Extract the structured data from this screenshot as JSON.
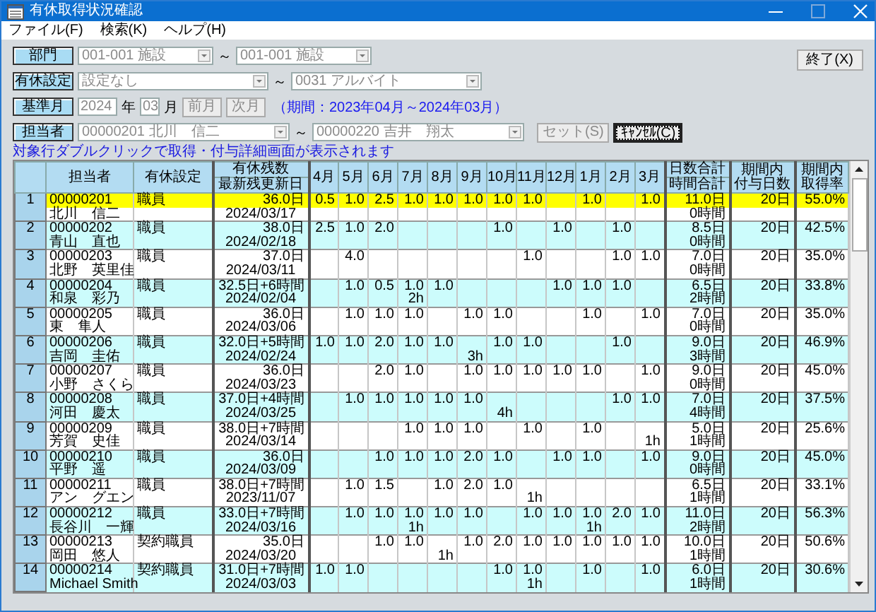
{
  "window": {
    "title": "有休取得状況確認"
  },
  "menu": [
    {
      "label": "ファイル(F)"
    },
    {
      "label": "検索(K)"
    },
    {
      "label": "ヘルプ(H)"
    }
  ],
  "filters": [
    {
      "label": "部門",
      "from": "001-001 施設",
      "separator": "～",
      "to": "001-001 施設",
      "disabled": true
    },
    {
      "label": "有休設定",
      "from": "設定なし",
      "separator": "～",
      "to": "0031 アルバイト",
      "disabled": true
    }
  ],
  "base_month": {
    "label": "基準月",
    "year": "2024",
    "year_unit": "年",
    "month": "03",
    "month_unit": "月",
    "prev": "前月",
    "next": "次月",
    "period": "（期間：2023年04月～2024年03月）",
    "disabled": true
  },
  "staff_range": {
    "label": "担当者",
    "from": "00000201 北川　信二",
    "separator": "～",
    "to": "00000220 吉井　翔太",
    "disabled": true,
    "set_button": {
      "label": "セット(S)",
      "disabled": true
    },
    "cancel_button": {
      "label": "ｷｬﾝｾﾙ(C)",
      "disabled": false
    }
  },
  "exit_button": "終了(X)",
  "hint": "対象行ダブルクリックで取得・付与詳細画面が表示されます",
  "table": {
    "columns": {
      "staff": "担当者",
      "setting": "有休設定",
      "balance": "有休残数",
      "updated": "最新残更新日",
      "months": [
        "4月",
        "5月",
        "6月",
        "7月",
        "8月",
        "9月",
        "10月",
        "11月",
        "12月",
        "1月",
        "2月",
        "3月"
      ],
      "day_total": "日数合計",
      "hour_total": "時間合計",
      "granted": [
        "期間内",
        "付与日数"
      ],
      "rate": [
        "期間内",
        "取得率"
      ]
    },
    "rows": [
      {
        "no": "1",
        "code": "00000201",
        "name": "北川　信二",
        "setting": "職員",
        "balance": "36.0日",
        "updated": "2024/03/17",
        "months": [
          {
            "kind": "taken",
            "days": "0.5"
          },
          {
            "kind": "taken",
            "days": "1.0"
          },
          {
            "kind": "taken",
            "days": "2.5"
          },
          {
            "kind": "taken",
            "days": "1.0"
          },
          {
            "kind": "taken",
            "days": "1.0"
          },
          {
            "kind": "taken",
            "days": "1.0"
          },
          {
            "kind": "taken",
            "days": "1.0"
          },
          {
            "kind": "taken",
            "days": "1.0"
          },
          {
            "kind": "blank"
          },
          {
            "kind": "taken",
            "days": "1.0"
          },
          {
            "kind": "blank"
          },
          {
            "kind": "taken",
            "days": "1.0"
          }
        ],
        "day_total": "11.0日",
        "hour_total": "0時間",
        "granted": "20日",
        "rate": "55.0%",
        "selected": true
      },
      {
        "no": "2",
        "code": "00000202",
        "name": "青山　直也",
        "setting": "職員",
        "balance": "38.0日",
        "updated": "2024/02/18",
        "months": [
          {
            "kind": "taken",
            "days": "2.5"
          },
          {
            "kind": "taken",
            "days": "1.0"
          },
          {
            "kind": "taken",
            "days": "2.0"
          },
          {
            "kind": "blank"
          },
          {
            "kind": "blank"
          },
          {
            "kind": "blank"
          },
          {
            "kind": "taken",
            "days": "1.0"
          },
          {
            "kind": "blank"
          },
          {
            "kind": "taken",
            "days": "1.0"
          },
          {
            "kind": "blank"
          },
          {
            "kind": "taken",
            "days": "1.0"
          },
          {
            "kind": "blank"
          }
        ],
        "day_total": "8.5日",
        "hour_total": "0時間",
        "granted": "20日",
        "rate": "42.5%",
        "selected": false
      },
      {
        "no": "3",
        "code": "00000203",
        "name": "北野　英里佳",
        "setting": "職員",
        "balance": "37.0日",
        "updated": "2024/03/11",
        "months": [
          {
            "kind": "blank"
          },
          {
            "kind": "taken",
            "days": "4.0"
          },
          {
            "kind": "blank"
          },
          {
            "kind": "blank"
          },
          {
            "kind": "blank"
          },
          {
            "kind": "blank"
          },
          {
            "kind": "blank"
          },
          {
            "kind": "taken",
            "days": "1.0"
          },
          {
            "kind": "blank"
          },
          {
            "kind": "blank"
          },
          {
            "kind": "taken",
            "days": "1.0"
          },
          {
            "kind": "taken",
            "days": "1.0"
          }
        ],
        "day_total": "7.0日",
        "hour_total": "0時間",
        "granted": "20日",
        "rate": "35.0%",
        "selected": false
      },
      {
        "no": "4",
        "code": "00000204",
        "name": "和泉　彩乃",
        "setting": "職員",
        "balance": "32.5日+6時間",
        "updated": "2024/02/04",
        "months": [
          {
            "kind": "blank"
          },
          {
            "kind": "taken",
            "days": "1.0"
          },
          {
            "kind": "taken",
            "days": "0.5"
          },
          {
            "kind": "taken",
            "days": "1.0",
            "hours": "2h"
          },
          {
            "kind": "taken",
            "days": "1.0"
          },
          {
            "kind": "blank"
          },
          {
            "kind": "blank"
          },
          {
            "kind": "blank"
          },
          {
            "kind": "taken",
            "days": "1.0"
          },
          {
            "kind": "taken",
            "days": "1.0"
          },
          {
            "kind": "taken",
            "days": "1.0"
          },
          {
            "kind": "blank"
          }
        ],
        "day_total": "6.5日",
        "hour_total": "2時間",
        "granted": "20日",
        "rate": "33.8%",
        "selected": false
      },
      {
        "no": "5",
        "code": "00000205",
        "name": "東　隼人",
        "setting": "職員",
        "balance": "36.0日",
        "updated": "2024/03/06",
        "months": [
          {
            "kind": "blank"
          },
          {
            "kind": "taken",
            "days": "1.0"
          },
          {
            "kind": "taken",
            "days": "1.0"
          },
          {
            "kind": "taken",
            "days": "1.0"
          },
          {
            "kind": "blank"
          },
          {
            "kind": "taken",
            "days": "1.0"
          },
          {
            "kind": "taken",
            "days": "1.0"
          },
          {
            "kind": "blank"
          },
          {
            "kind": "blank"
          },
          {
            "kind": "taken",
            "days": "1.0"
          },
          {
            "kind": "blank"
          },
          {
            "kind": "taken",
            "days": "1.0"
          }
        ],
        "day_total": "7.0日",
        "hour_total": "0時間",
        "granted": "20日",
        "rate": "35.0%",
        "selected": false
      },
      {
        "no": "6",
        "code": "00000206",
        "name": "吉岡　圭佑",
        "setting": "職員",
        "balance": "32.0日+5時間",
        "updated": "2024/02/24",
        "months": [
          {
            "kind": "taken",
            "days": "1.0"
          },
          {
            "kind": "taken",
            "days": "1.0"
          },
          {
            "kind": "taken",
            "days": "2.0"
          },
          {
            "kind": "taken",
            "days": "1.0"
          },
          {
            "kind": "taken",
            "days": "1.0"
          },
          {
            "kind": "taken",
            "hours": "3h"
          },
          {
            "kind": "taken",
            "days": "1.0"
          },
          {
            "kind": "taken",
            "days": "1.0"
          },
          {
            "kind": "blank"
          },
          {
            "kind": "blank"
          },
          {
            "kind": "taken",
            "days": "1.0"
          },
          {
            "kind": "blank"
          }
        ],
        "day_total": "9.0日",
        "hour_total": "3時間",
        "granted": "20日",
        "rate": "46.9%",
        "selected": false
      },
      {
        "no": "7",
        "code": "00000207",
        "name": "小野　さくら",
        "setting": "職員",
        "balance": "36.0日",
        "updated": "2024/03/23",
        "months": [
          {
            "kind": "blank"
          },
          {
            "kind": "blank"
          },
          {
            "kind": "taken",
            "days": "2.0"
          },
          {
            "kind": "taken",
            "days": "1.0"
          },
          {
            "kind": "blank"
          },
          {
            "kind": "taken",
            "days": "1.0"
          },
          {
            "kind": "taken",
            "days": "1.0"
          },
          {
            "kind": "taken",
            "days": "1.0"
          },
          {
            "kind": "taken",
            "days": "1.0"
          },
          {
            "kind": "taken",
            "days": "1.0"
          },
          {
            "kind": "blank"
          },
          {
            "kind": "taken",
            "days": "1.0"
          }
        ],
        "day_total": "9.0日",
        "hour_total": "0時間",
        "granted": "20日",
        "rate": "45.0%",
        "selected": false
      },
      {
        "no": "8",
        "code": "00000208",
        "name": "河田　慶太",
        "setting": "職員",
        "balance": "37.0日+4時間",
        "updated": "2024/03/25",
        "months": [
          {
            "kind": "blank"
          },
          {
            "kind": "taken",
            "days": "1.0"
          },
          {
            "kind": "taken",
            "days": "1.0"
          },
          {
            "kind": "taken",
            "days": "1.0"
          },
          {
            "kind": "taken",
            "days": "1.0"
          },
          {
            "kind": "taken",
            "days": "1.0"
          },
          {
            "kind": "taken",
            "hours": "4h"
          },
          {
            "kind": "blank"
          },
          {
            "kind": "blank"
          },
          {
            "kind": "blank"
          },
          {
            "kind": "taken",
            "days": "1.0"
          },
          {
            "kind": "taken",
            "days": "1.0"
          }
        ],
        "day_total": "7.0日",
        "hour_total": "4時間",
        "granted": "20日",
        "rate": "37.5%",
        "selected": false
      },
      {
        "no": "9",
        "code": "00000209",
        "name": "芳賀　史佳",
        "setting": "職員",
        "balance": "38.0日+7時間",
        "updated": "2024/03/14",
        "months": [
          {
            "kind": "blank"
          },
          {
            "kind": "blank"
          },
          {
            "kind": "blank"
          },
          {
            "kind": "taken",
            "days": "1.0"
          },
          {
            "kind": "taken",
            "days": "1.0"
          },
          {
            "kind": "taken",
            "days": "1.0"
          },
          {
            "kind": "blank"
          },
          {
            "kind": "taken",
            "days": "1.0"
          },
          {
            "kind": "blank"
          },
          {
            "kind": "taken",
            "days": "1.0"
          },
          {
            "kind": "blank"
          },
          {
            "kind": "taken",
            "hours": "1h"
          }
        ],
        "day_total": "5.0日",
        "hour_total": "1時間",
        "granted": "20日",
        "rate": "25.6%",
        "selected": false
      },
      {
        "no": "10",
        "code": "00000210",
        "name": "平野　遥",
        "setting": "職員",
        "balance": "36.0日",
        "updated": "2024/03/09",
        "months": [
          {
            "kind": "blank"
          },
          {
            "kind": "blank"
          },
          {
            "kind": "taken",
            "days": "1.0"
          },
          {
            "kind": "taken",
            "days": "1.0"
          },
          {
            "kind": "taken",
            "days": "1.0"
          },
          {
            "kind": "taken",
            "days": "2.0"
          },
          {
            "kind": "taken",
            "days": "1.0"
          },
          {
            "kind": "blank"
          },
          {
            "kind": "taken",
            "days": "1.0"
          },
          {
            "kind": "taken",
            "days": "1.0"
          },
          {
            "kind": "blank"
          },
          {
            "kind": "taken",
            "days": "1.0"
          }
        ],
        "day_total": "9.0日",
        "hour_total": "0時間",
        "granted": "20日",
        "rate": "45.0%",
        "selected": false
      },
      {
        "no": "11",
        "code": "00000211",
        "name": "アン　グエン",
        "setting": "職員",
        "balance": "38.0日+7時間",
        "updated": "2023/11/07",
        "months": [
          {
            "kind": "blank"
          },
          {
            "kind": "taken",
            "days": "1.0"
          },
          {
            "kind": "taken",
            "days": "1.5"
          },
          {
            "kind": "blank"
          },
          {
            "kind": "taken",
            "days": "1.0"
          },
          {
            "kind": "taken",
            "days": "2.0"
          },
          {
            "kind": "taken",
            "days": "1.0"
          },
          {
            "kind": "taken",
            "hours": "1h"
          },
          {
            "kind": "blank"
          },
          {
            "kind": "blank"
          },
          {
            "kind": "blank"
          },
          {
            "kind": "blank"
          }
        ],
        "day_total": "6.5日",
        "hour_total": "1時間",
        "granted": "20日",
        "rate": "33.1%",
        "selected": false
      },
      {
        "no": "12",
        "code": "00000212",
        "name": "長谷川　一輝",
        "setting": "職員",
        "balance": "33.0日+7時間",
        "updated": "2024/03/16",
        "months": [
          {
            "kind": "blank"
          },
          {
            "kind": "taken",
            "days": "1.0"
          },
          {
            "kind": "taken",
            "days": "1.0"
          },
          {
            "kind": "taken",
            "days": "1.0",
            "hours": "1h"
          },
          {
            "kind": "taken",
            "days": "1.0"
          },
          {
            "kind": "taken",
            "days": "1.0"
          },
          {
            "kind": "blank"
          },
          {
            "kind": "taken",
            "days": "1.0"
          },
          {
            "kind": "taken",
            "days": "1.0"
          },
          {
            "kind": "taken",
            "days": "1.0",
            "hours": "1h"
          },
          {
            "kind": "taken",
            "days": "2.0"
          },
          {
            "kind": "taken",
            "days": "1.0"
          }
        ],
        "day_total": "11.0日",
        "hour_total": "2時間",
        "granted": "20日",
        "rate": "56.3%",
        "selected": false
      },
      {
        "no": "13",
        "code": "00000213",
        "name": "岡田　悠人",
        "setting": "契約職員",
        "balance": "35.0日",
        "updated": "2024/03/20",
        "months": [
          {
            "kind": "blank"
          },
          {
            "kind": "blank"
          },
          {
            "kind": "taken",
            "days": "1.0"
          },
          {
            "kind": "taken",
            "days": "1.0"
          },
          {
            "kind": "taken",
            "hours": "1h"
          },
          {
            "kind": "taken",
            "days": "1.0"
          },
          {
            "kind": "taken",
            "days": "2.0"
          },
          {
            "kind": "taken",
            "days": "1.0"
          },
          {
            "kind": "taken",
            "days": "1.0"
          },
          {
            "kind": "taken",
            "days": "1.0"
          },
          {
            "kind": "taken",
            "days": "1.0"
          },
          {
            "kind": "taken",
            "days": "1.0"
          }
        ],
        "day_total": "10.0日",
        "hour_total": "1時間",
        "granted": "20日",
        "rate": "50.6%",
        "selected": false
      },
      {
        "no": "14",
        "code": "00000214",
        "name": "Michael Smith",
        "setting": "契約職員",
        "balance": "31.0日+7時間",
        "updated": "2024/03/03",
        "months": [
          {
            "kind": "taken",
            "days": "1.0"
          },
          {
            "kind": "taken",
            "days": "1.0"
          },
          {
            "kind": "blank"
          },
          {
            "kind": "blank"
          },
          {
            "kind": "blank"
          },
          {
            "kind": "blank"
          },
          {
            "kind": "taken",
            "days": "1.0"
          },
          {
            "kind": "taken",
            "days": "1.0",
            "hours": "1h"
          },
          {
            "kind": "blank"
          },
          {
            "kind": "taken",
            "days": "1.0"
          },
          {
            "kind": "blank"
          },
          {
            "kind": "taken",
            "days": "1.0"
          }
        ],
        "day_total": "6.0日",
        "hour_total": "1時間",
        "granted": "20日",
        "rate": "30.6%",
        "selected": false
      }
    ]
  }
}
